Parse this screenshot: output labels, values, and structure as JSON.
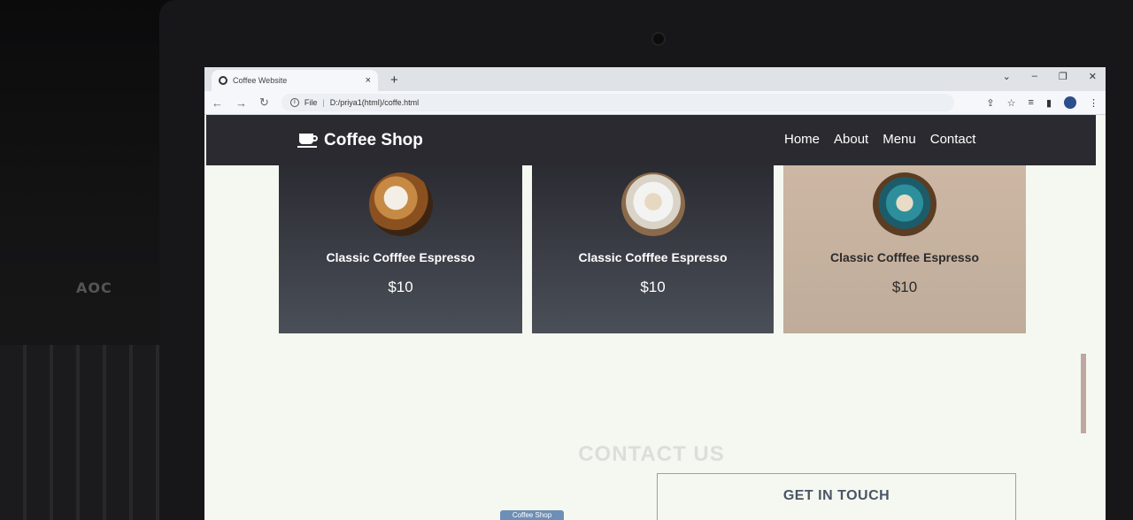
{
  "monitor": {
    "brand": "AOC"
  },
  "browser": {
    "tab_title": "Coffee Website",
    "tab_close": "×",
    "new_tab": "+",
    "window_controls": [
      "⌄",
      "–",
      "❐",
      "✕"
    ],
    "nav_icons": [
      "←",
      "→",
      "↻"
    ],
    "address_prefix": "File",
    "address_url": "D:/priya1(html)/coffe.html",
    "toolbar_icons": [
      "share-icon",
      "star-icon",
      "reading-list-icon",
      "sidebar-icon",
      "profile-icon",
      "more-icon"
    ]
  },
  "page": {
    "logo_text": "Coffee Shop",
    "nav": [
      "Home",
      "About",
      "Menu",
      "Contact"
    ],
    "cards": [
      {
        "name": "Classic Cofffee Espresso",
        "price": "$10"
      },
      {
        "name": "Classic Cofffee Espresso",
        "price": "$10"
      },
      {
        "name": "Classic Cofffee Espresso",
        "price": "$10"
      }
    ],
    "contact_title": "CONTACT US",
    "get_in_touch": "GET IN TOUCH",
    "footer_badge": "Coffee Shop"
  }
}
